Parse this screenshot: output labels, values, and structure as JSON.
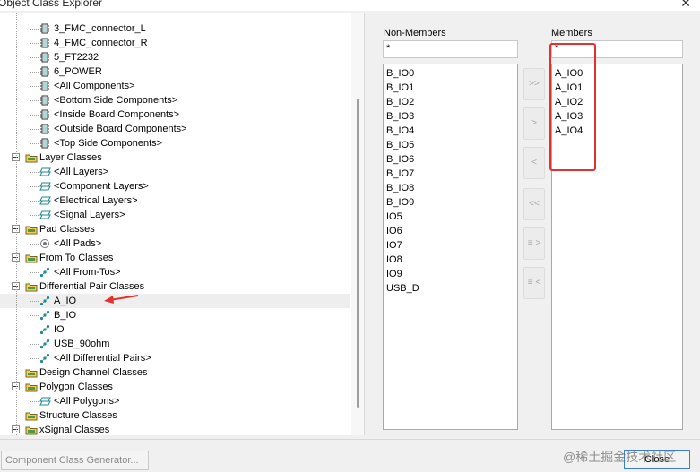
{
  "window": {
    "title": "Object Class Explorer",
    "close_glyph": "✕"
  },
  "tree": {
    "rows": [
      {
        "label": "3_FMC_connector_L",
        "icon": "component-class-icon"
      },
      {
        "label": "4_FMC_connector_R",
        "icon": "component-class-icon"
      },
      {
        "label": "5_FT2232",
        "icon": "component-class-icon"
      },
      {
        "label": "6_POWER",
        "icon": "component-class-icon"
      },
      {
        "label": "<All Components>",
        "icon": "component-class-icon"
      },
      {
        "label": "<Bottom Side Components>",
        "icon": "component-class-icon"
      },
      {
        "label": "<Inside Board Components>",
        "icon": "component-class-icon"
      },
      {
        "label": "<Outside Board Components>",
        "icon": "component-class-icon"
      },
      {
        "label": "<Top Side Components>",
        "icon": "component-class-icon"
      },
      {
        "label": "Layer Classes",
        "icon": "folder-icon"
      },
      {
        "label": "<All Layers>",
        "icon": "layer-icon"
      },
      {
        "label": "<Component Layers>",
        "icon": "layer-icon"
      },
      {
        "label": "<Electrical Layers>",
        "icon": "layer-icon"
      },
      {
        "label": "<Signal Layers>",
        "icon": "layer-icon"
      },
      {
        "label": "Pad Classes",
        "icon": "folder-icon"
      },
      {
        "label": "<All Pads>",
        "icon": "pad-icon"
      },
      {
        "label": "From To Classes",
        "icon": "folder-icon"
      },
      {
        "label": "<All From-Tos>",
        "icon": "net-icon"
      },
      {
        "label": "Differential Pair Classes",
        "icon": "folder-icon"
      },
      {
        "label": "A_IO",
        "icon": "net-icon"
      },
      {
        "label": "B_IO",
        "icon": "net-icon"
      },
      {
        "label": "IO",
        "icon": "net-icon"
      },
      {
        "label": "USB_90ohm",
        "icon": "net-icon"
      },
      {
        "label": "<All Differential Pairs>",
        "icon": "net-icon"
      },
      {
        "label": "Design Channel Classes",
        "icon": "folder-icon"
      },
      {
        "label": "Polygon Classes",
        "icon": "folder-icon"
      },
      {
        "label": "<All Polygons>",
        "icon": "layer-icon"
      },
      {
        "label": "Structure Classes",
        "icon": "folder-icon"
      },
      {
        "label": "xSignal Classes",
        "icon": "folder-icon"
      }
    ]
  },
  "non_members": {
    "label": "Non-Members",
    "filter": "*",
    "items": [
      "B_IO0",
      "B_IO1",
      "B_IO2",
      "B_IO3",
      "B_IO4",
      "B_IO5",
      "B_IO6",
      "B_IO7",
      "B_IO8",
      "B_IO9",
      "IO5",
      "IO6",
      "IO7",
      "IO8",
      "IO9",
      "USB_D"
    ]
  },
  "members": {
    "label": "Members",
    "filter": "*",
    "items": [
      "A_IO0",
      "A_IO1",
      "A_IO2",
      "A_IO3",
      "A_IO4"
    ]
  },
  "move_buttons": [
    {
      "label": ">>"
    },
    {
      "label": ">"
    },
    {
      "label": "<"
    },
    {
      "label": "<<"
    },
    {
      "label": "≡ >"
    },
    {
      "label": "≡ <"
    }
  ],
  "footer": {
    "generator_label": "Component Class Generator...",
    "close_label": "Close",
    "watermark": "@稀土掘金技术社区"
  },
  "colors": {
    "annotation_red": "#e0332f",
    "selected_row": "#eeeeee",
    "folder_yellow": "#f2cf5b",
    "icon_teal": "#1f8a8f"
  }
}
